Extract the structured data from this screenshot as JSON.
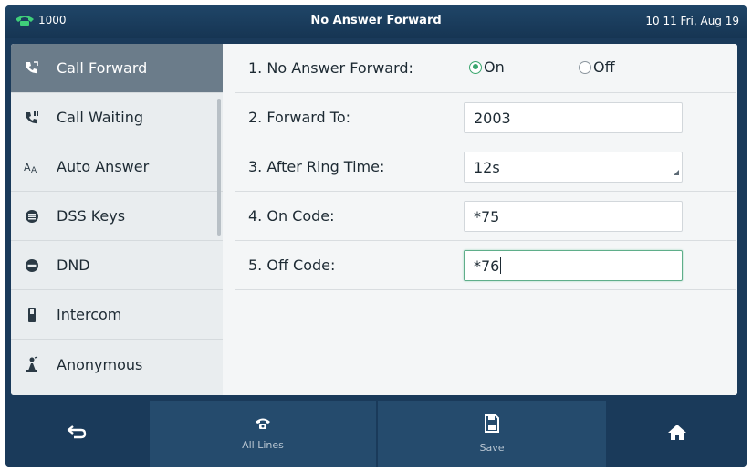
{
  "statusbar": {
    "line": "1000",
    "title": "No Answer Forward",
    "datetime": "10 11 Fri, Aug 19",
    "line_icon": "phone-handset-icon"
  },
  "sidebar": {
    "items": [
      {
        "label": "Call Forward",
        "icon": "call-forward-icon",
        "active": true
      },
      {
        "label": "Call Waiting",
        "icon": "call-waiting-icon",
        "active": false
      },
      {
        "label": "Auto Answer",
        "icon": "auto-answer-icon",
        "active": false
      },
      {
        "label": "DSS Keys",
        "icon": "dss-keys-icon",
        "active": false
      },
      {
        "label": "DND",
        "icon": "dnd-icon",
        "active": false
      },
      {
        "label": "Intercom",
        "icon": "intercom-icon",
        "active": false
      },
      {
        "label": "Anonymous",
        "icon": "anonymous-icon",
        "active": false
      }
    ]
  },
  "form": {
    "no_answer_forward": {
      "label": "1. No Answer Forward:",
      "on_label": "On",
      "off_label": "Off",
      "selected": "On"
    },
    "forward_to": {
      "label": "2. Forward To:",
      "value": "2003"
    },
    "after_ring_time": {
      "label": "3. After Ring Time:",
      "value": "12s"
    },
    "on_code": {
      "label": "4. On Code:",
      "value": "*75"
    },
    "off_code": {
      "label": "5. Off Code:",
      "value": "*76"
    }
  },
  "softkeys": {
    "back_icon": "back-arrow-icon",
    "all_lines_label": "All Lines",
    "save_label": "Save",
    "home_icon": "home-icon"
  },
  "colors": {
    "accent_green": "#3aa66e",
    "frame_dark": "#1a3a5a",
    "active_item": "#6b7c8a"
  }
}
